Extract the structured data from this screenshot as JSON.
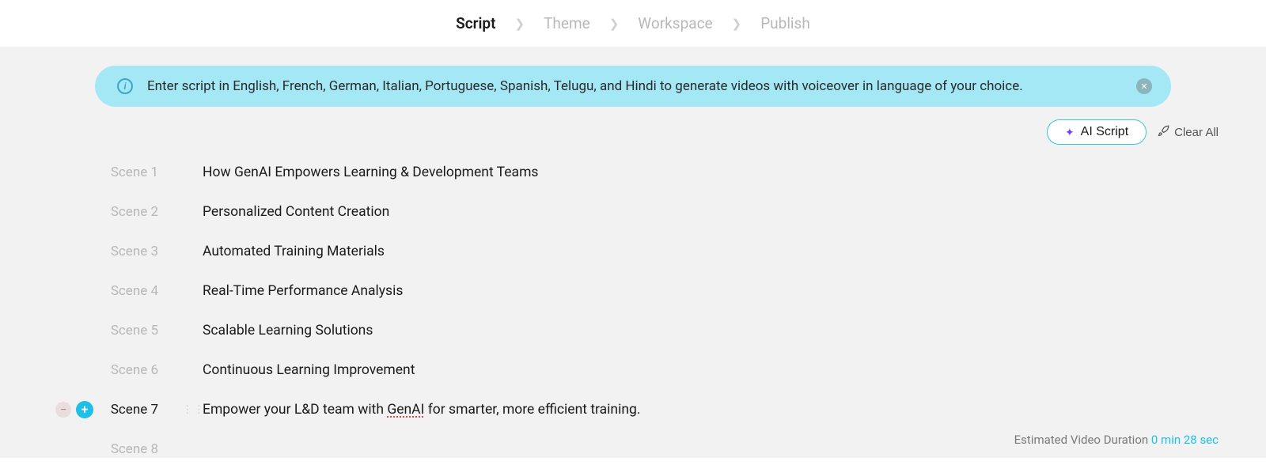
{
  "breadcrumb": {
    "steps": [
      "Script",
      "Theme",
      "Workspace",
      "Publish"
    ],
    "active_index": 0
  },
  "banner": {
    "text": "Enter script in English, French, German, Italian, Portuguese, Spanish, Telugu, and Hindi to generate videos with voiceover in language of your choice."
  },
  "toolbar": {
    "ai_script_label": "AI Script",
    "clear_all_label": "Clear All"
  },
  "scenes": [
    {
      "label": "Scene 1",
      "text": "How GenAI Empowers Learning & Development Teams",
      "active": false
    },
    {
      "label": "Scene 2",
      "text": "Personalized Content Creation",
      "active": false
    },
    {
      "label": "Scene 3",
      "text": "Automated Training Materials",
      "active": false
    },
    {
      "label": "Scene 4",
      "text": "Real-Time Performance Analysis",
      "active": false
    },
    {
      "label": "Scene 5",
      "text": "Scalable Learning Solutions",
      "active": false
    },
    {
      "label": "Scene 6",
      "text": "Continuous Learning Improvement",
      "active": false
    },
    {
      "label": "Scene 7",
      "text_parts": [
        "Empower your L&D team with ",
        "GenAI",
        " for smarter, more efficient training."
      ],
      "active": true,
      "spellcheck_word_index": 1
    },
    {
      "label": "Scene 8",
      "text": "",
      "active": false
    }
  ],
  "footer": {
    "label": "Estimated Video Duration",
    "value": "0 min 28 sec"
  }
}
